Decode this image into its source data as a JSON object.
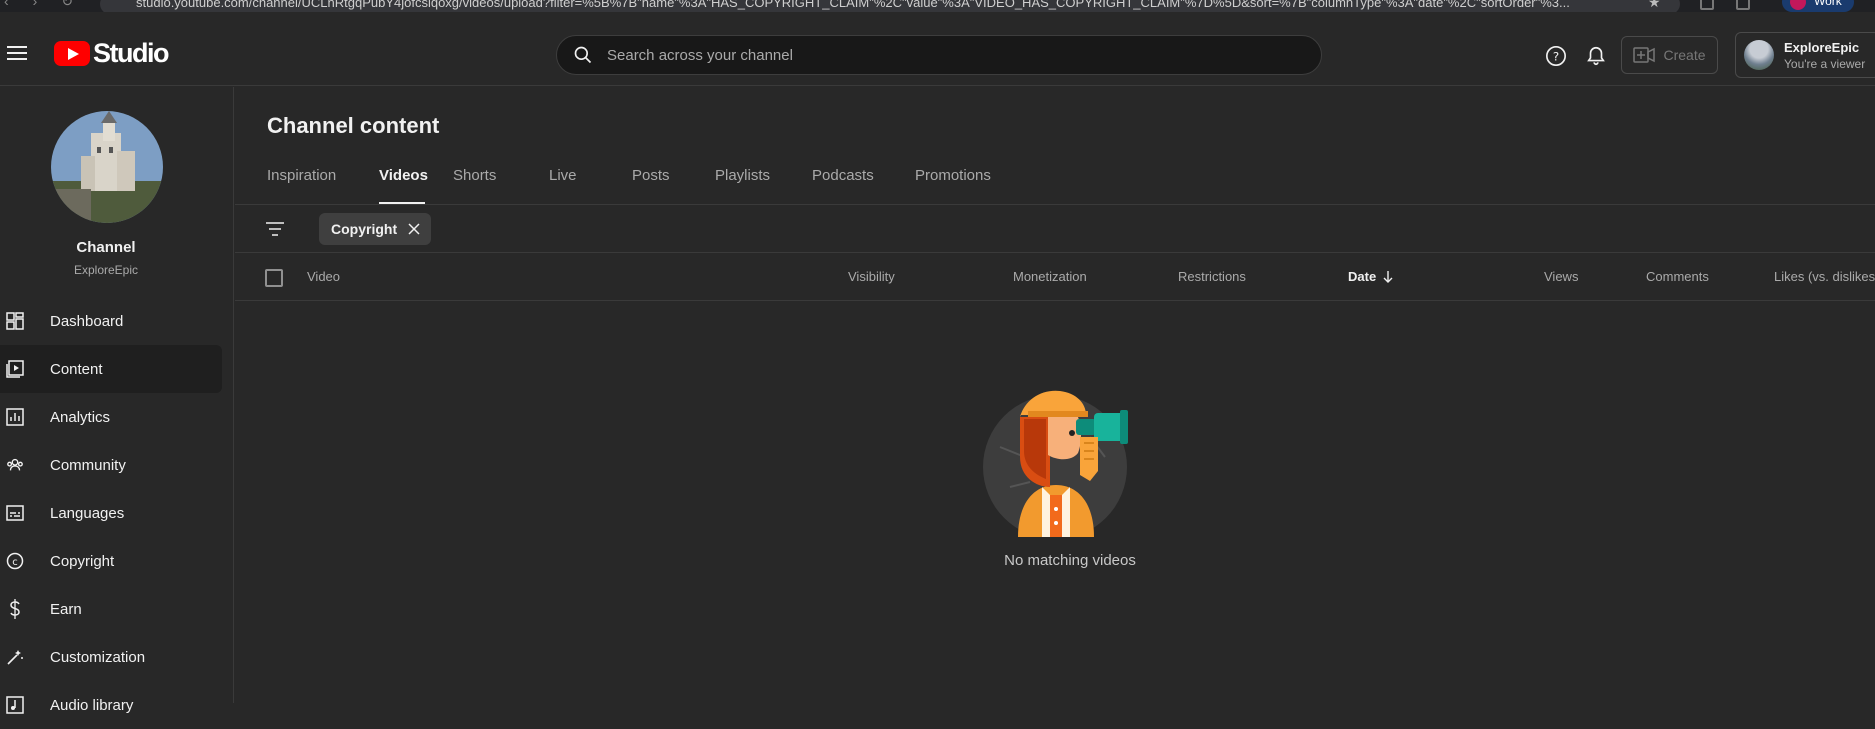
{
  "browser": {
    "url": "studio.youtube.com/channel/UCLnRtgqPubY4jofcsiqoxg/videos/upload?filter=%5B%7B\"name\"%3A\"HAS_COPYRIGHT_CLAIM\"%2C\"value\"%3A\"VIDEO_HAS_COPYRIGHT_CLAIM\"%7D%5D&sort=%7B\"columnType\"%3A\"date\"%2C\"sortOrder\"%3...",
    "profile_label": "Work"
  },
  "header": {
    "logo_text": "Studio",
    "search_placeholder": "Search across your channel",
    "create_label": "Create",
    "account_name": "ExploreEpic",
    "account_role": "You're a viewer"
  },
  "sidebar": {
    "channel_title": "Channel",
    "channel_handle": "ExploreEpic",
    "items": [
      {
        "label": "Dashboard",
        "icon": "dashboard-icon"
      },
      {
        "label": "Content",
        "icon": "content-icon",
        "active": true
      },
      {
        "label": "Analytics",
        "icon": "analytics-icon"
      },
      {
        "label": "Community",
        "icon": "community-icon"
      },
      {
        "label": "Languages",
        "icon": "languages-icon"
      },
      {
        "label": "Copyright",
        "icon": "copyright-icon"
      },
      {
        "label": "Earn",
        "icon": "earn-icon"
      },
      {
        "label": "Customization",
        "icon": "customization-icon"
      },
      {
        "label": "Audio library",
        "icon": "audio-library-icon"
      }
    ]
  },
  "main": {
    "title": "Channel content",
    "tabs": [
      {
        "label": "Inspiration"
      },
      {
        "label": "Videos",
        "active": true
      },
      {
        "label": "Shorts"
      },
      {
        "label": "Live"
      },
      {
        "label": "Posts"
      },
      {
        "label": "Playlists"
      },
      {
        "label": "Podcasts"
      },
      {
        "label": "Promotions"
      }
    ],
    "filter_chip": "Copyright",
    "columns": {
      "video": "Video",
      "visibility": "Visibility",
      "monetization": "Monetization",
      "restrictions": "Restrictions",
      "date": "Date",
      "views": "Views",
      "comments": "Comments",
      "likes": "Likes (vs. dislikes)"
    },
    "sort_direction": "descending",
    "empty_message": "No matching videos"
  },
  "colors": {
    "background": "#282828",
    "brand_red": "#ff0000",
    "text_primary": "#f1f1f1",
    "text_secondary": "#aaaaaa"
  }
}
